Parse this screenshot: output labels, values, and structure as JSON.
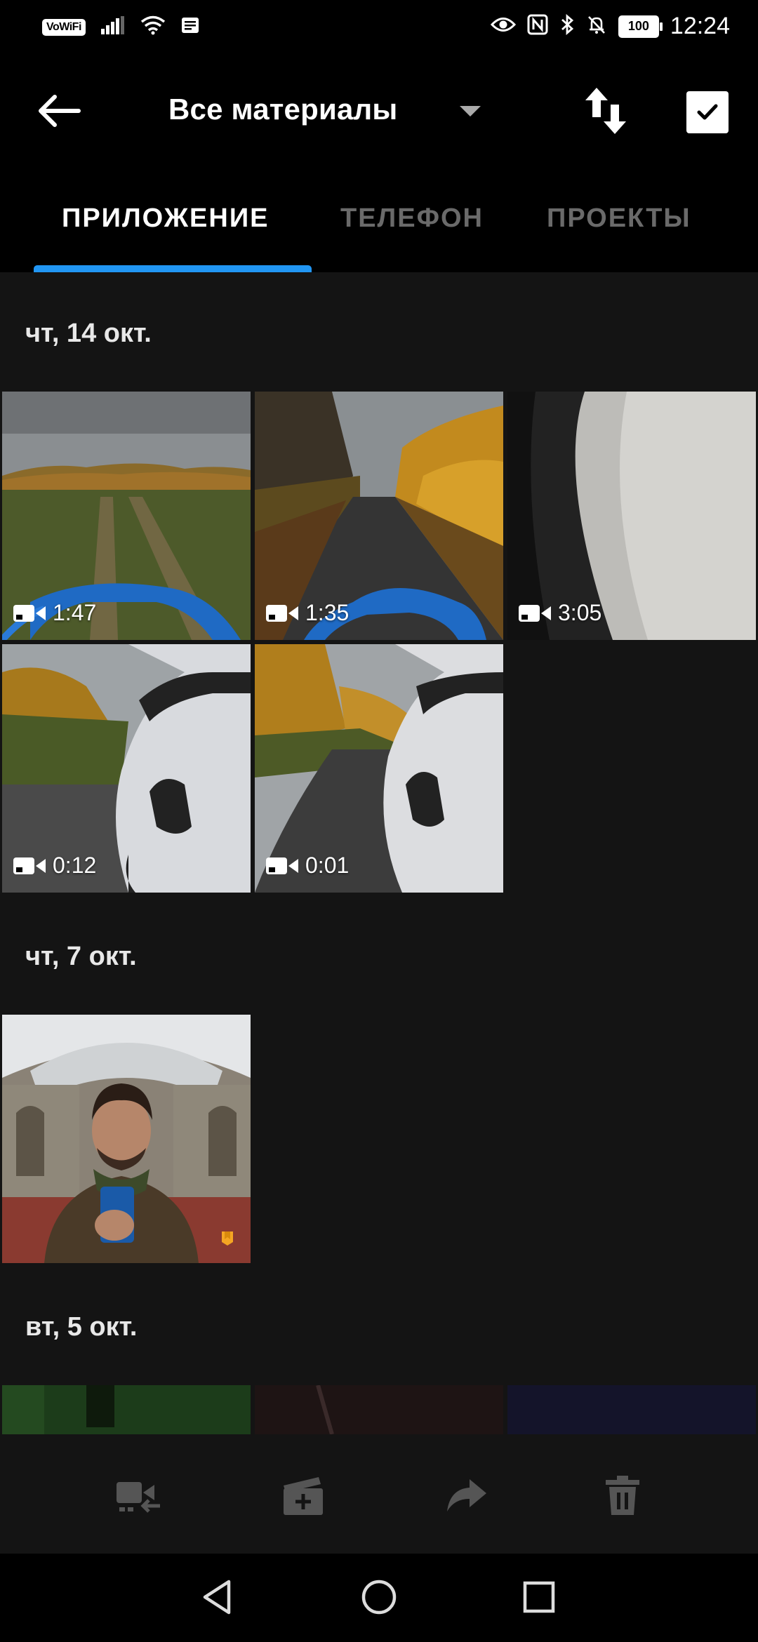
{
  "status_bar": {
    "vowifi": "VoWiFi",
    "battery": "100",
    "time": "12:24"
  },
  "header": {
    "title": "Все материалы"
  },
  "tabs": [
    {
      "label": "ПРИЛОЖЕНИЕ",
      "active": true
    },
    {
      "label": "ТЕЛЕФОН",
      "active": false
    },
    {
      "label": "ПРОЕКТЫ",
      "active": false
    }
  ],
  "colors": {
    "accent": "#2196f3",
    "background": "#141414",
    "header_bg": "#000000",
    "inactive_tab": "#6a6a6a",
    "badge_orange": "#f5a623"
  },
  "sections": [
    {
      "date": "чт, 14 окт.",
      "items": [
        {
          "type": "video",
          "duration": "1:47"
        },
        {
          "type": "video",
          "duration": "1:35"
        },
        {
          "type": "video",
          "duration": "3:05"
        },
        {
          "type": "video",
          "duration": "0:12"
        },
        {
          "type": "video",
          "duration": "0:01"
        }
      ]
    },
    {
      "date": "чт, 7 окт.",
      "items": [
        {
          "type": "photo",
          "badge": "orange-tag-icon"
        }
      ]
    },
    {
      "date": "вт, 5 окт.",
      "items": [
        {
          "type": "partial"
        },
        {
          "type": "partial"
        },
        {
          "type": "partial"
        }
      ]
    }
  ],
  "actions": [
    "import-to-phone-icon",
    "create-clip-icon",
    "share-icon",
    "delete-icon"
  ],
  "nav": [
    "back-triangle-icon",
    "home-circle-icon",
    "recents-square-icon"
  ]
}
